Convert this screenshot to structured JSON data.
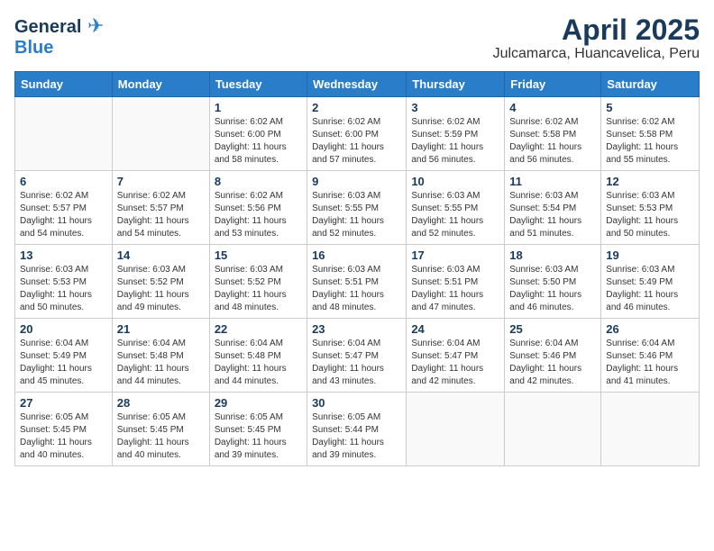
{
  "header": {
    "logo_general": "General",
    "logo_blue": "Blue",
    "month": "April 2025",
    "location": "Julcamarca, Huancavelica, Peru"
  },
  "weekdays": [
    "Sunday",
    "Monday",
    "Tuesday",
    "Wednesday",
    "Thursday",
    "Friday",
    "Saturday"
  ],
  "weeks": [
    [
      {
        "day": "",
        "info": ""
      },
      {
        "day": "",
        "info": ""
      },
      {
        "day": "1",
        "info": "Sunrise: 6:02 AM\nSunset: 6:00 PM\nDaylight: 11 hours and 58 minutes."
      },
      {
        "day": "2",
        "info": "Sunrise: 6:02 AM\nSunset: 6:00 PM\nDaylight: 11 hours and 57 minutes."
      },
      {
        "day": "3",
        "info": "Sunrise: 6:02 AM\nSunset: 5:59 PM\nDaylight: 11 hours and 56 minutes."
      },
      {
        "day": "4",
        "info": "Sunrise: 6:02 AM\nSunset: 5:58 PM\nDaylight: 11 hours and 56 minutes."
      },
      {
        "day": "5",
        "info": "Sunrise: 6:02 AM\nSunset: 5:58 PM\nDaylight: 11 hours and 55 minutes."
      }
    ],
    [
      {
        "day": "6",
        "info": "Sunrise: 6:02 AM\nSunset: 5:57 PM\nDaylight: 11 hours and 54 minutes."
      },
      {
        "day": "7",
        "info": "Sunrise: 6:02 AM\nSunset: 5:57 PM\nDaylight: 11 hours and 54 minutes."
      },
      {
        "day": "8",
        "info": "Sunrise: 6:02 AM\nSunset: 5:56 PM\nDaylight: 11 hours and 53 minutes."
      },
      {
        "day": "9",
        "info": "Sunrise: 6:03 AM\nSunset: 5:55 PM\nDaylight: 11 hours and 52 minutes."
      },
      {
        "day": "10",
        "info": "Sunrise: 6:03 AM\nSunset: 5:55 PM\nDaylight: 11 hours and 52 minutes."
      },
      {
        "day": "11",
        "info": "Sunrise: 6:03 AM\nSunset: 5:54 PM\nDaylight: 11 hours and 51 minutes."
      },
      {
        "day": "12",
        "info": "Sunrise: 6:03 AM\nSunset: 5:53 PM\nDaylight: 11 hours and 50 minutes."
      }
    ],
    [
      {
        "day": "13",
        "info": "Sunrise: 6:03 AM\nSunset: 5:53 PM\nDaylight: 11 hours and 50 minutes."
      },
      {
        "day": "14",
        "info": "Sunrise: 6:03 AM\nSunset: 5:52 PM\nDaylight: 11 hours and 49 minutes."
      },
      {
        "day": "15",
        "info": "Sunrise: 6:03 AM\nSunset: 5:52 PM\nDaylight: 11 hours and 48 minutes."
      },
      {
        "day": "16",
        "info": "Sunrise: 6:03 AM\nSunset: 5:51 PM\nDaylight: 11 hours and 48 minutes."
      },
      {
        "day": "17",
        "info": "Sunrise: 6:03 AM\nSunset: 5:51 PM\nDaylight: 11 hours and 47 minutes."
      },
      {
        "day": "18",
        "info": "Sunrise: 6:03 AM\nSunset: 5:50 PM\nDaylight: 11 hours and 46 minutes."
      },
      {
        "day": "19",
        "info": "Sunrise: 6:03 AM\nSunset: 5:49 PM\nDaylight: 11 hours and 46 minutes."
      }
    ],
    [
      {
        "day": "20",
        "info": "Sunrise: 6:04 AM\nSunset: 5:49 PM\nDaylight: 11 hours and 45 minutes."
      },
      {
        "day": "21",
        "info": "Sunrise: 6:04 AM\nSunset: 5:48 PM\nDaylight: 11 hours and 44 minutes."
      },
      {
        "day": "22",
        "info": "Sunrise: 6:04 AM\nSunset: 5:48 PM\nDaylight: 11 hours and 44 minutes."
      },
      {
        "day": "23",
        "info": "Sunrise: 6:04 AM\nSunset: 5:47 PM\nDaylight: 11 hours and 43 minutes."
      },
      {
        "day": "24",
        "info": "Sunrise: 6:04 AM\nSunset: 5:47 PM\nDaylight: 11 hours and 42 minutes."
      },
      {
        "day": "25",
        "info": "Sunrise: 6:04 AM\nSunset: 5:46 PM\nDaylight: 11 hours and 42 minutes."
      },
      {
        "day": "26",
        "info": "Sunrise: 6:04 AM\nSunset: 5:46 PM\nDaylight: 11 hours and 41 minutes."
      }
    ],
    [
      {
        "day": "27",
        "info": "Sunrise: 6:05 AM\nSunset: 5:45 PM\nDaylight: 11 hours and 40 minutes."
      },
      {
        "day": "28",
        "info": "Sunrise: 6:05 AM\nSunset: 5:45 PM\nDaylight: 11 hours and 40 minutes."
      },
      {
        "day": "29",
        "info": "Sunrise: 6:05 AM\nSunset: 5:45 PM\nDaylight: 11 hours and 39 minutes."
      },
      {
        "day": "30",
        "info": "Sunrise: 6:05 AM\nSunset: 5:44 PM\nDaylight: 11 hours and 39 minutes."
      },
      {
        "day": "",
        "info": ""
      },
      {
        "day": "",
        "info": ""
      },
      {
        "day": "",
        "info": ""
      }
    ]
  ]
}
